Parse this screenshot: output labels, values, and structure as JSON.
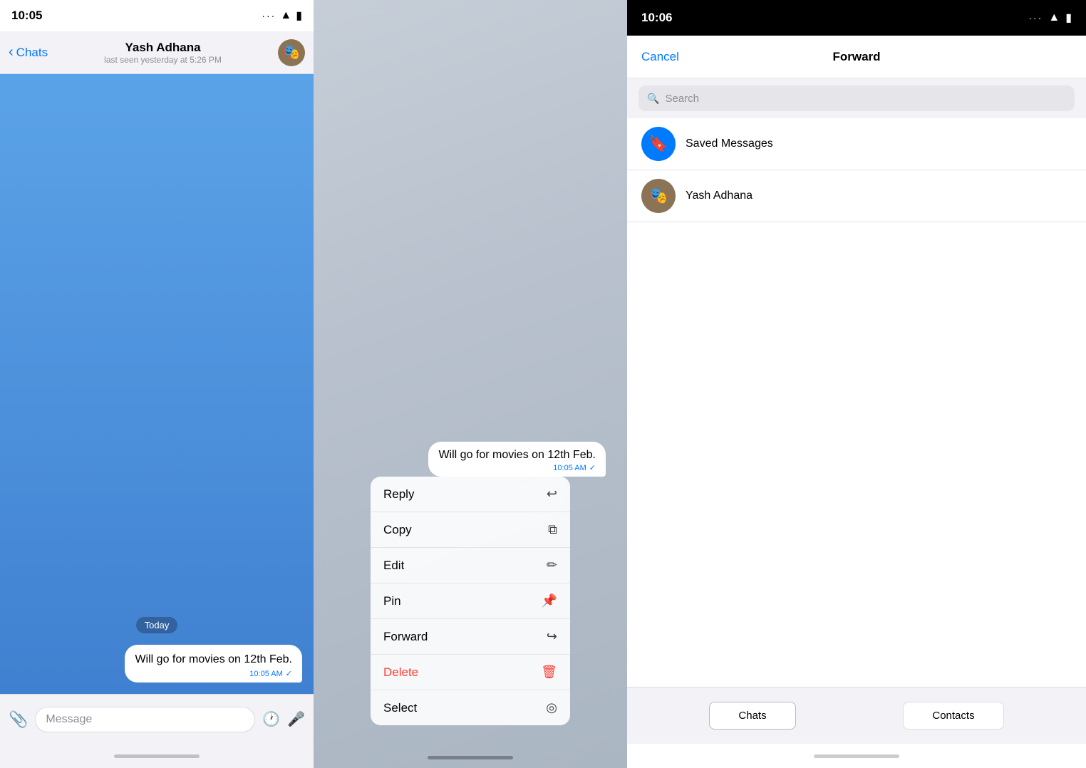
{
  "panel1": {
    "statusTime": "10:05",
    "contactName": "Yash Adhana",
    "contactStatus": "last seen yesterday at 5:26 PM",
    "backLabel": "Chats",
    "dateBadge": "Today",
    "messageText": "Will go for movies on 12th Feb.",
    "messageTime": "10:05 AM",
    "inputPlaceholder": "Message"
  },
  "panel2": {
    "previewText": "Will go for movies on 12th Feb.",
    "previewTime": "10:05 AM",
    "menuItems": [
      {
        "label": "Reply",
        "icon": "↩",
        "isDelete": false
      },
      {
        "label": "Copy",
        "icon": "⧉",
        "isDelete": false
      },
      {
        "label": "Edit",
        "icon": "✏",
        "isDelete": false
      },
      {
        "label": "Pin",
        "icon": "📌",
        "isDelete": false
      },
      {
        "label": "Forward",
        "icon": "↪",
        "isDelete": false
      },
      {
        "label": "Delete",
        "icon": "🗑",
        "isDelete": true
      },
      {
        "label": "Select",
        "icon": "✓",
        "isDelete": false
      }
    ]
  },
  "panel3": {
    "statusTime": "10:06",
    "cancelLabel": "Cancel",
    "forwardTitle": "Forward",
    "searchPlaceholder": "Search",
    "contacts": [
      {
        "name": "Saved Messages",
        "type": "bookmark"
      },
      {
        "name": "Yash Adhana",
        "type": "user"
      }
    ],
    "tabs": [
      {
        "label": "Chats"
      },
      {
        "label": "Contacts"
      }
    ]
  }
}
